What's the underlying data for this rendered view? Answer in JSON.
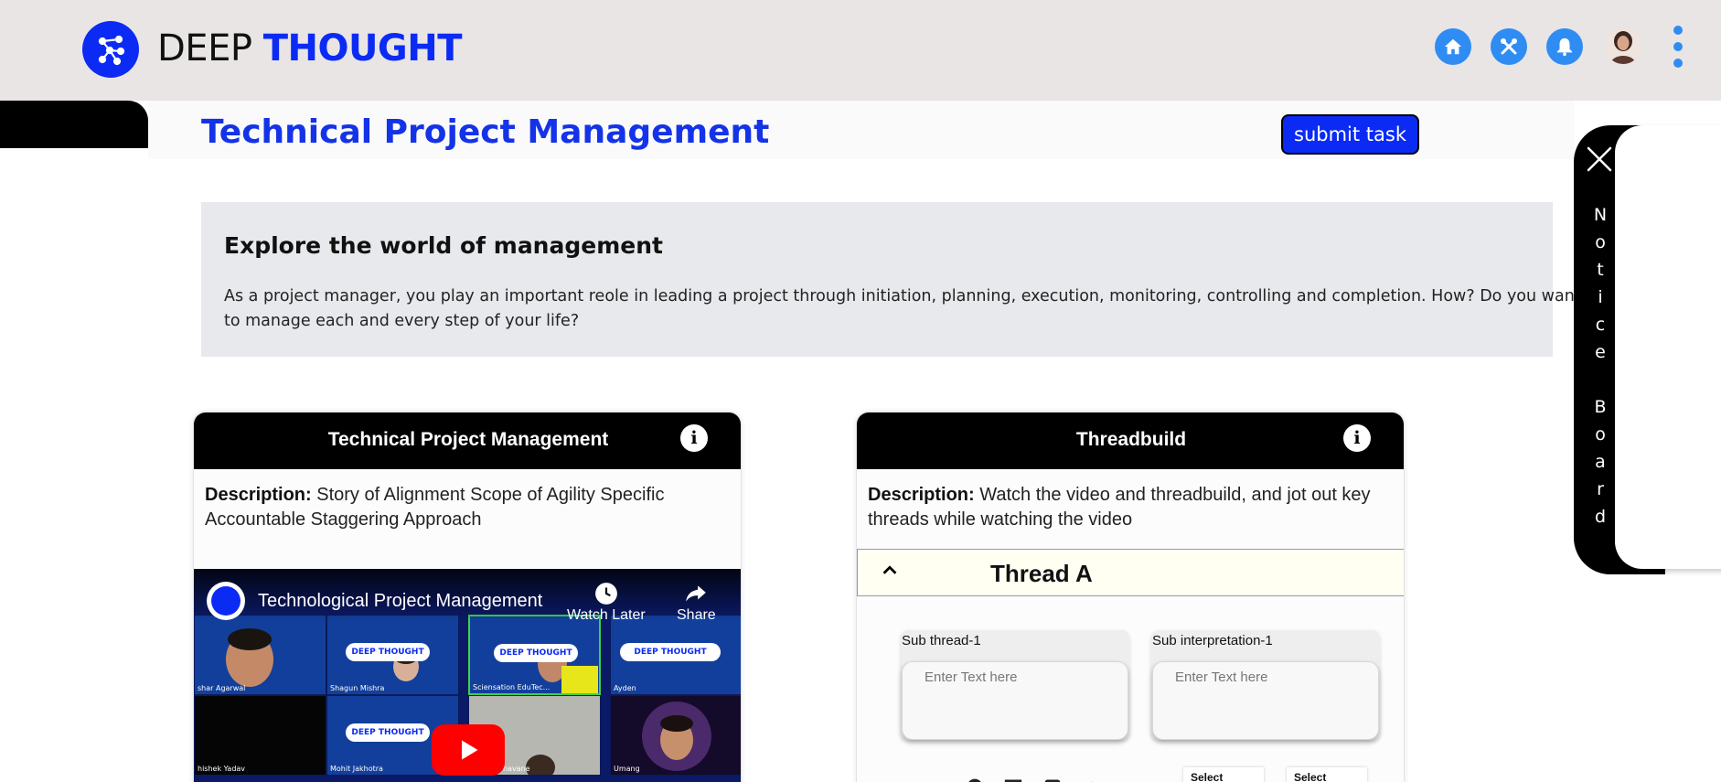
{
  "header": {
    "brand_first": "DEEP",
    "brand_second": "THOUGHT",
    "icons": [
      "home-icon",
      "tools-icon",
      "bell-icon",
      "avatar",
      "kebab-menu-icon"
    ]
  },
  "page": {
    "title": "Technical Project Management",
    "submit_label": "submit task"
  },
  "intro": {
    "heading": "Explore the world of management",
    "text": "As a project manager, you play an important reole in leading a project through initiation, planning, execution, monitoring, controlling and completion. How? Do you want to manage each and every step of your life?"
  },
  "cards": [
    {
      "title": "Technical Project Management",
      "info": "i",
      "desc_label": "Description:",
      "desc_text": " Story of Alignment Scope of Agility Specific Accountable Staggering Approach",
      "video": {
        "title": "Technological Project Management",
        "watch_later": "Watch Later",
        "share": "Share",
        "tiles": [
          "shar Agarwal",
          "Shagun Mishra",
          "Sciensation EduTec...",
          "Ayden",
          "hishek Yadav",
          "Mohit Jakhotra",
          "Pooja Sonavane",
          "Umang"
        ],
        "pill_text": "DEEP THOUGHT"
      }
    },
    {
      "title": "Threadbuild",
      "info": "i",
      "desc_label": "Description:",
      "desc_text": " Watch the video and threadbuild, and jot out key threads while watching the video",
      "thread": {
        "title": "Thread A",
        "sub_thread_label": "Sub thread-1",
        "sub_interp_label": "Sub interpretation-1",
        "placeholder": "Enter Text here",
        "select_1": "Select",
        "select_2": "Select"
      }
    }
  ],
  "notice_board": {
    "letters": [
      "N",
      "o",
      "t",
      "i",
      "c",
      "e",
      " ",
      "B",
      "o",
      "a",
      "r",
      "d"
    ]
  },
  "colors": {
    "brand_blue": "#0b2bf5",
    "icon_blue": "#2f8cf3",
    "header_bg": "#e9e5e5",
    "intro_bg": "#e7e9ec"
  }
}
